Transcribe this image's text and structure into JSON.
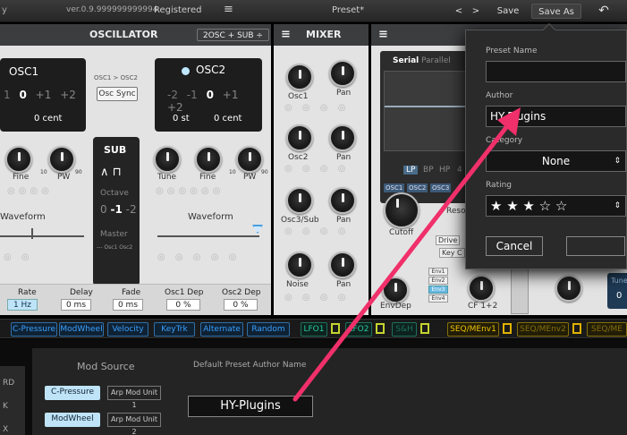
{
  "topbar": {
    "version": "ver.0.9.999999999994",
    "registered": "Registered",
    "menu_icon": "hamburger-icon",
    "preset": "Preset*",
    "prev": "<",
    "next": ">",
    "save": "Save",
    "save_as": "Save As",
    "undo_icon": "undo-icon"
  },
  "osc": {
    "title": "OSCILLATOR",
    "mode": "2OSC + SUB",
    "mode_arrow": "÷",
    "osc1": {
      "name": "OSC1",
      "values": [
        "1",
        "0",
        "+1",
        "+2"
      ],
      "cent": "0 cent"
    },
    "osc1_to_osc2": "OSC1 > OSC2",
    "osc_sync": "Osc Sync",
    "osc2": {
      "name": "OSC2",
      "values": [
        "-2",
        "-1",
        "0",
        "+1",
        "+2"
      ],
      "st": "0 st",
      "cent": "0 cent"
    },
    "sub": {
      "title": "SUB",
      "octave": "Octave",
      "oct_values": [
        "0",
        "-1",
        "-2"
      ],
      "master": "Master",
      "master_opts": "--- Osc1 Osc2"
    },
    "knobs_left": [
      "Fine",
      "PW"
    ],
    "knobs_right": [
      "Tune",
      "Fine",
      "PW"
    ],
    "pw_min": "10",
    "pw_max": "90",
    "waveform_left": "Waveform",
    "waveform_right": "Waveform",
    "bottom": {
      "rate_label": "Rate",
      "rate": "1 Hz",
      "delay_label": "Delay",
      "delay": "0 ms",
      "fade_label": "Fade",
      "fade": "0 ms",
      "osc1dep_label": "Osc1 Dep",
      "osc1dep": "0 %",
      "osc2dep_label": "Osc2 Dep",
      "osc2dep": "0 %"
    }
  },
  "mixer": {
    "title": "MIXER",
    "rows": [
      {
        "a": "Osc1",
        "b": "Pan"
      },
      {
        "a": "Osc2",
        "b": "Pan"
      },
      {
        "a": "Osc3/Sub",
        "b": "Pan"
      },
      {
        "a": "Noise",
        "b": "Pan"
      }
    ]
  },
  "filter": {
    "tabs": [
      "Serial",
      "Parallel"
    ],
    "modes": [
      "LP",
      "BP",
      "HP",
      "4"
    ],
    "osc_sel": [
      "OSC1",
      "OSC2",
      "OSC3"
    ],
    "cutoff": "Cutoff",
    "reso": "Reso",
    "drive": "Drive",
    "key": "Key C",
    "env": [
      "Env1",
      "Env2",
      "Env3",
      "Env4"
    ],
    "envdep": "EnvDep",
    "cf": "CF 1+2",
    "tune": "Tune",
    "tune_val": "0"
  },
  "modbar": {
    "items": [
      "C-Pressure",
      "ModWheel",
      "Velocity",
      "KeyTrk",
      "Alternate",
      "Random"
    ],
    "lfos": [
      "LFO1",
      "LFO2",
      "S&H"
    ],
    "seqs": [
      "SEQ/MEnv1",
      "SEQ/MEnv2",
      "SEQ/ME"
    ]
  },
  "bottom": {
    "mod_source": "Mod Source",
    "default_author": "Default Preset Author Name",
    "sources": [
      "C-Pressure",
      "ModWheel"
    ],
    "arp_units": [
      "Arp Mod Unit 1",
      "Arp Mod Unit 2"
    ],
    "author_value": "HY-Plugins",
    "left_stub": [
      "RD",
      "K",
      "X"
    ]
  },
  "dialog": {
    "preset_name_label": "Preset Name",
    "preset_name_value": "",
    "author_label": "Author",
    "author_value": "HY-Plugins",
    "category_label": "Category",
    "category_value": "None",
    "rating_label": "Rating",
    "stars": "★ ★ ★ ☆ ☆",
    "cancel": "Cancel",
    "ok": ""
  },
  "annotation": {
    "color": "#f0306a"
  }
}
